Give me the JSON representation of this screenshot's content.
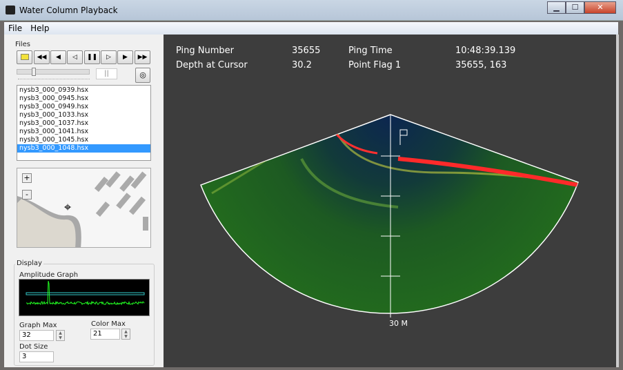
{
  "window": {
    "title": "Water Column Playback",
    "controls": [
      "minimize",
      "maximize",
      "close"
    ]
  },
  "menu": [
    {
      "label": "File"
    },
    {
      "label": "Help"
    }
  ],
  "files": {
    "group_label": "Files",
    "toolbar": [
      "open-folder",
      "first",
      "step-back",
      "play-back",
      "pause",
      "play-forward",
      "step-forward",
      "last"
    ],
    "toolbar_glyphs": [
      "",
      "◀◀",
      "◀",
      "◁",
      "❚❚",
      "▷",
      "▶",
      "▶▶"
    ],
    "pause_indicator": "||",
    "list": [
      "nysb3_000_0939.hsx",
      "nysb3_000_0945.hsx",
      "nysb3_000_0949.hsx",
      "nysb3_000_1033.hsx",
      "nysb3_000_1037.hsx",
      "nysb3_000_1041.hsx",
      "nysb3_000_1045.hsx",
      "nysb3_000_1048.hsx"
    ],
    "selected_index": 7,
    "map_zoom_in": "+",
    "map_zoom_out": "-"
  },
  "display": {
    "group_label": "Display",
    "amplitude_label": "Amplitude Graph",
    "graph_max_label": "Graph Max",
    "graph_max": "32",
    "color_max_label": "Color Max",
    "color_max": "21",
    "dot_size_label": "Dot Size",
    "dot_size": "3"
  },
  "info": {
    "ping_number_label": "Ping Number",
    "ping_number": "35655",
    "ping_time_label": "Ping Time",
    "ping_time": "10:48:39.139",
    "depth_label": "Depth at Cursor",
    "depth": "30.2",
    "flag_label": "Point Flag 1",
    "flag": "35655, 163"
  },
  "sonar": {
    "range_label": "30 M"
  },
  "colors": {
    "selection": "#3399ff",
    "background": "#3d3d3d",
    "water": "#0d2a4a",
    "signal": "#2e8a1a",
    "strong": "#ff2020"
  }
}
